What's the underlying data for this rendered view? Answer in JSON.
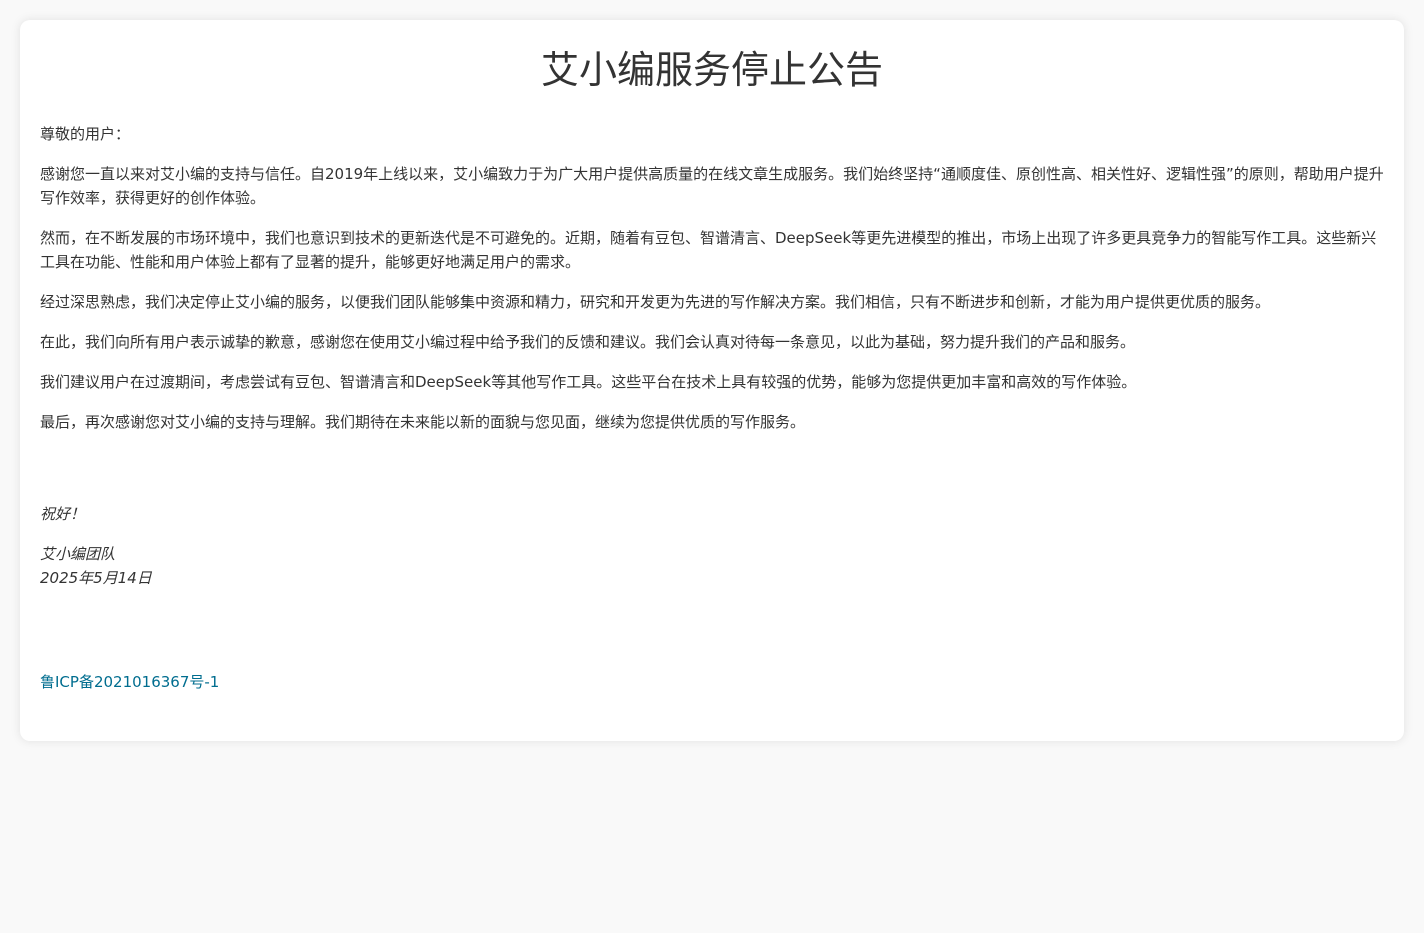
{
  "notice": {
    "title": "艾小编服务停止公告",
    "paragraphs": [
      "尊敬的用户：",
      "感谢您一直以来对艾小编的支持与信任。自2019年上线以来，艾小编致力于为广大用户提供高质量的在线文章生成服务。我们始终坚持“通顺度佳、原创性高、相关性好、逻辑性强”的原则，帮助用户提升写作效率，获得更好的创作体验。",
      "然而，在不断发展的市场环境中，我们也意识到技术的更新迭代是不可避免的。近期，随着有豆包、智谱清言、DeepSeek等更先进模型的推出，市场上出现了许多更具竞争力的智能写作工具。这些新兴工具在功能、性能和用户体验上都有了显著的提升，能够更好地满足用户的需求。",
      "经过深思熟虑，我们决定停止艾小编的服务，以便我们团队能够集中资源和精力，研究和开发更为先进的写作解决方案。我们相信，只有不断进步和创新，才能为用户提供更优质的服务。",
      "在此，我们向所有用户表示诚挚的歉意，感谢您在使用艾小编过程中给予我们的反馈和建议。我们会认真对待每一条意见，以此为基础，努力提升我们的产品和服务。",
      "我们建议用户在过渡期间，考虑尝试有豆包、智谱清言和DeepSeek等其他写作工具。这些平台在技术上具有较强的优势，能够为您提供更加丰富和高效的写作体验。",
      "最后，再次感谢您对艾小编的支持与理解。我们期待在未来能以新的面貌与您见面，继续为您提供优质的写作服务。"
    ],
    "greeting": "祝好！",
    "signature": {
      "team": "艾小编团队",
      "date": "2025年5月14日"
    }
  },
  "footer": {
    "icp_link": "鲁ICP备2021016367号-1"
  },
  "colors": {
    "page_background": "#f9f9f9",
    "card_background": "#ffffff",
    "text": "#333333",
    "link": "#006d8f"
  }
}
